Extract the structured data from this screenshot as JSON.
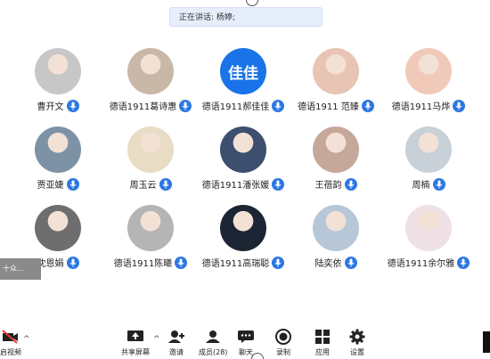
{
  "banner": {
    "text": "正在讲话: 杨婷;"
  },
  "participants": [
    {
      "name": "曹开文",
      "avatar_type": "photo",
      "avatar_color": "#c7c7c7"
    },
    {
      "name": "德语1911葛诗惠",
      "avatar_type": "photo",
      "avatar_color": "#c9b8a8"
    },
    {
      "name": "德语1911郝佳佳",
      "avatar_type": "text",
      "avatar_text": "佳佳",
      "avatar_color": "#1a73e8"
    },
    {
      "name": "德语1911 范臻",
      "avatar_type": "photo",
      "avatar_color": "#e8c4b4"
    },
    {
      "name": "德语1911马烨",
      "avatar_type": "photo",
      "avatar_color": "#f1c9b9"
    },
    {
      "name": "贾亚婕",
      "avatar_type": "photo",
      "avatar_color": "#7d92a5"
    },
    {
      "name": "周玉云",
      "avatar_type": "photo",
      "avatar_color": "#e9dcc4"
    },
    {
      "name": "德语1911潘张媛",
      "avatar_type": "photo",
      "avatar_color": "#3c4f6e"
    },
    {
      "name": "王蓓韵",
      "avatar_type": "photo",
      "avatar_color": "#c6a89a"
    },
    {
      "name": "周楠",
      "avatar_type": "photo",
      "avatar_color": "#c8d0d8"
    },
    {
      "name": "沈恩娟",
      "avatar_type": "photo",
      "avatar_color": "#6e6e6e"
    },
    {
      "name": "德语1911陈曦",
      "avatar_type": "photo",
      "avatar_color": "#b5b5b5"
    },
    {
      "name": "德语1911高瑞聪",
      "avatar_type": "photo",
      "avatar_color": "#1c2533"
    },
    {
      "name": "陆奕依",
      "avatar_type": "photo",
      "avatar_color": "#b7c7d8"
    },
    {
      "name": "德语1911余尔雅",
      "avatar_type": "photo",
      "avatar_color": "#efe1e6"
    }
  ],
  "left_tab": {
    "label": "十众..."
  },
  "toolbar": {
    "video_label": "启视频",
    "share_label": "共享屏幕",
    "invite_label": "邀请",
    "members_label": "成员(28)",
    "chat_label": "聊天",
    "record_label": "录制",
    "apps_label": "应用",
    "settings_label": "设置"
  },
  "colors": {
    "accent": "#2d77e3",
    "banner_bg": "#e6eefb"
  }
}
